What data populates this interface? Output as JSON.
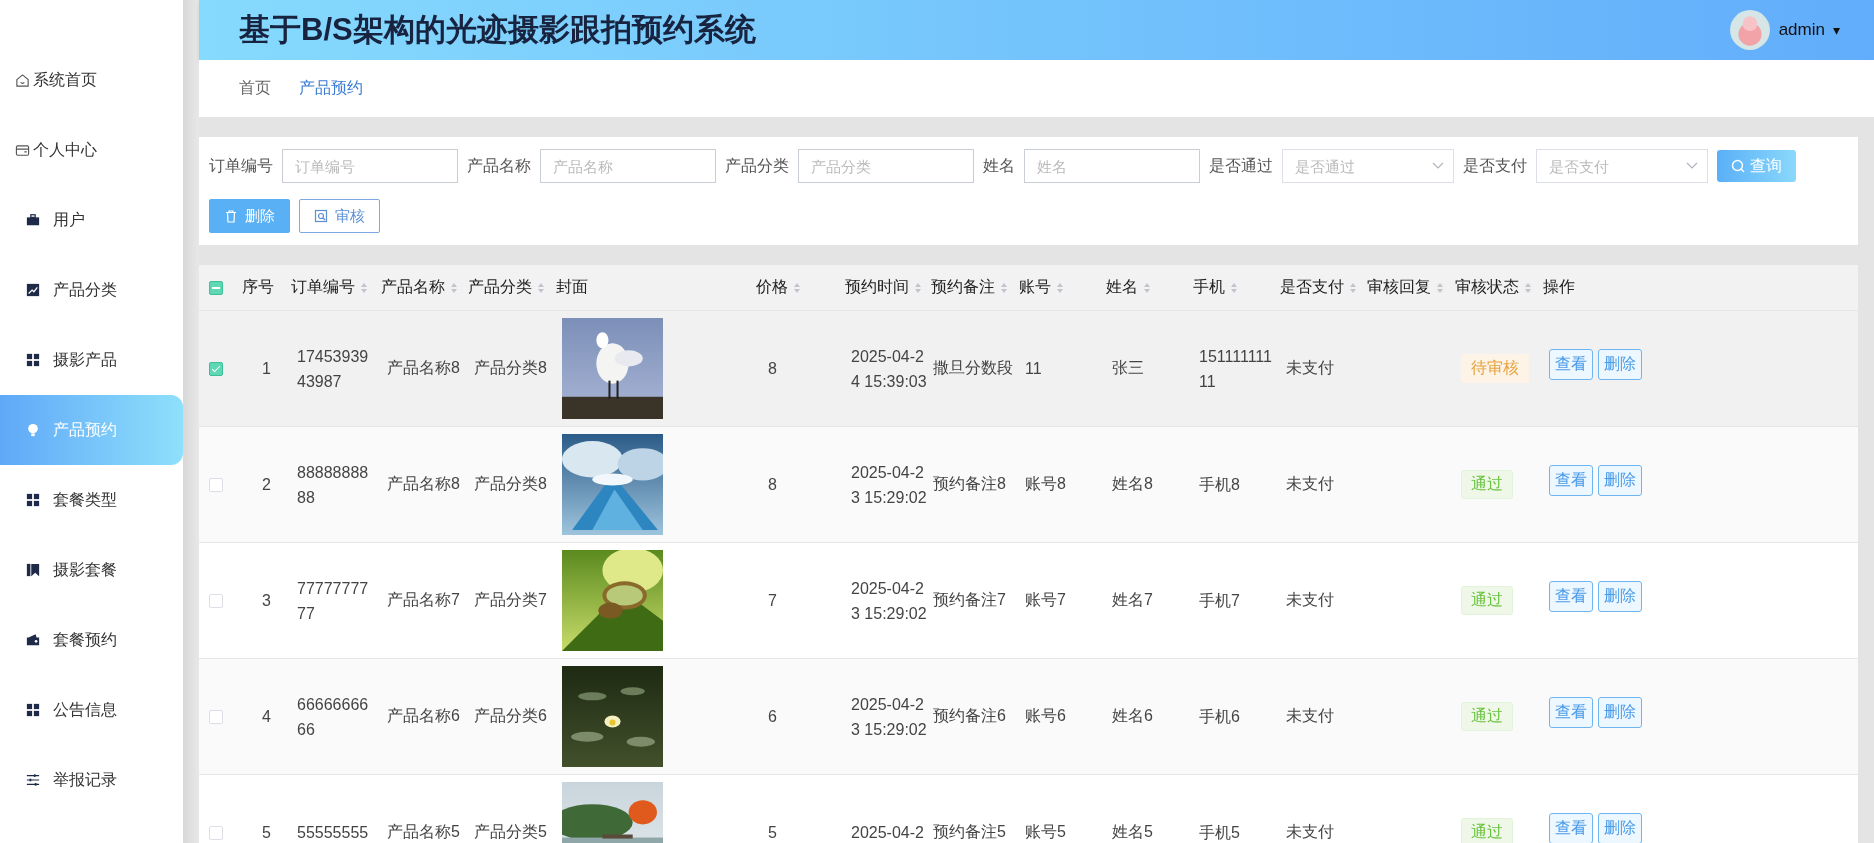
{
  "header": {
    "title": "基于B/S架构的光迹摄影跟拍预约系统",
    "user": "admin",
    "menu_caret": "▾"
  },
  "sidebar": {
    "items": [
      {
        "label": "系统首页",
        "kind": "link",
        "selected": false
      },
      {
        "label": "个人中心",
        "kind": "link",
        "selected": false
      },
      {
        "label": "用户",
        "kind": "menu",
        "selected": false
      },
      {
        "label": "产品分类",
        "kind": "menu",
        "selected": false
      },
      {
        "label": "摄影产品",
        "kind": "menu",
        "selected": false
      },
      {
        "label": "产品预约",
        "kind": "menu",
        "selected": true
      },
      {
        "label": "套餐类型",
        "kind": "menu",
        "selected": false
      },
      {
        "label": "摄影套餐",
        "kind": "menu",
        "selected": false
      },
      {
        "label": "套餐预约",
        "kind": "menu",
        "selected": false
      },
      {
        "label": "公告信息",
        "kind": "menu",
        "selected": false
      },
      {
        "label": "举报记录",
        "kind": "menu",
        "selected": false
      }
    ]
  },
  "breadcrumb": [
    {
      "label": "首页",
      "selected": false
    },
    {
      "label": "产品预约",
      "selected": true
    }
  ],
  "filters": [
    {
      "label": "订单编号",
      "placeholder": "订单编号",
      "kind": "input"
    },
    {
      "label": "产品名称",
      "placeholder": "产品名称",
      "kind": "input"
    },
    {
      "label": "产品分类",
      "placeholder": "产品分类",
      "kind": "input"
    },
    {
      "label": "姓名",
      "placeholder": "姓名",
      "kind": "input"
    },
    {
      "label": "是否通过",
      "placeholder": "是否通过",
      "kind": "select"
    },
    {
      "label": "是否支付",
      "placeholder": "是否支付",
      "kind": "select"
    }
  ],
  "query_button": "查询",
  "actions": [
    {
      "label": "删除",
      "kind": "primary"
    },
    {
      "label": "审核",
      "kind": "outline"
    }
  ],
  "table": {
    "header_checkbox": {
      "indeterminate": true
    },
    "columns": [
      {
        "label": "序号",
        "sortable": false
      },
      {
        "label": "订单编号",
        "sortable": true
      },
      {
        "label": "产品名称",
        "sortable": true
      },
      {
        "label": "产品分类",
        "sortable": true
      },
      {
        "label": "封面",
        "sortable": false
      },
      {
        "label": "价格",
        "sortable": true
      },
      {
        "label": "预约时间",
        "sortable": true
      },
      {
        "label": "预约备注",
        "sortable": true
      },
      {
        "label": "账号",
        "sortable": true
      },
      {
        "label": "姓名",
        "sortable": true
      },
      {
        "label": "手机",
        "sortable": true
      },
      {
        "label": "是否支付",
        "sortable": true
      },
      {
        "label": "审核回复",
        "sortable": true
      },
      {
        "label": "审核状态",
        "sortable": true
      },
      {
        "label": "操作",
        "sortable": false
      }
    ],
    "rows": [
      {
        "selected": true,
        "index": "1",
        "order_no": "1745393943987",
        "product_name": "产品名称8",
        "category": "产品分类8",
        "price": "8",
        "time": "2025-04-24 15:39:03",
        "note": "撒旦分数段",
        "account": "11",
        "name": "张三",
        "phone": "15111111111",
        "paid": "未支付",
        "status": {
          "text": "待审核",
          "kind": "pending"
        },
        "buttons": [
          "查看",
          "删除"
        ]
      },
      {
        "selected": false,
        "index": "2",
        "order_no": "8888888888",
        "product_name": "产品名称8",
        "category": "产品分类8",
        "price": "8",
        "time": "2025-04-23 15:29:02",
        "note": "预约备注8",
        "account": "账号8",
        "name": "姓名8",
        "phone": "手机8",
        "paid": "未支付",
        "status": {
          "text": "通过",
          "kind": "passed"
        },
        "buttons": [
          "查看",
          "删除"
        ]
      },
      {
        "selected": false,
        "index": "3",
        "order_no": "7777777777",
        "product_name": "产品名称7",
        "category": "产品分类7",
        "price": "7",
        "time": "2025-04-23 15:29:02",
        "note": "预约备注7",
        "account": "账号7",
        "name": "姓名7",
        "phone": "手机7",
        "paid": "未支付",
        "status": {
          "text": "通过",
          "kind": "passed"
        },
        "buttons": [
          "查看",
          "删除"
        ]
      },
      {
        "selected": false,
        "index": "4",
        "order_no": "6666666666",
        "product_name": "产品名称6",
        "category": "产品分类6",
        "price": "6",
        "time": "2025-04-23 15:29:02",
        "note": "预约备注6",
        "account": "账号6",
        "name": "姓名6",
        "phone": "手机6",
        "paid": "未支付",
        "status": {
          "text": "通过",
          "kind": "passed"
        },
        "buttons": [
          "查看",
          "删除"
        ]
      },
      {
        "selected": false,
        "index": "5",
        "order_no": "55555555",
        "product_name": "产品名称5",
        "category": "产品分类5",
        "price": "5",
        "time": "2025-04-2",
        "note": "预约备注5",
        "account": "账号5",
        "name": "姓名5",
        "phone": "手机5",
        "paid": "未支付",
        "status": {
          "text": "通过",
          "kind": "passed"
        },
        "buttons": [
          "查看",
          "删除"
        ]
      }
    ]
  }
}
